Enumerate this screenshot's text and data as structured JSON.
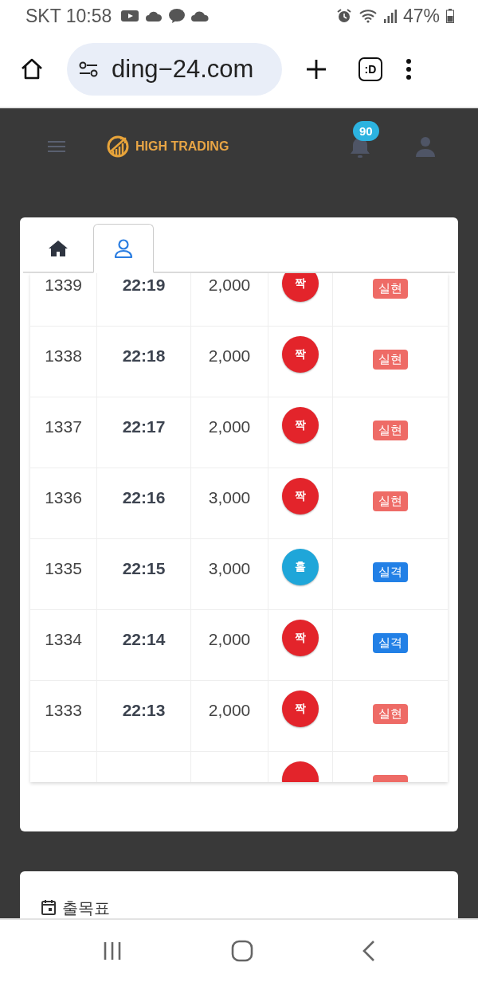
{
  "status_bar": {
    "carrier": "SKT",
    "time": "10:58",
    "battery": "47%"
  },
  "browser": {
    "url": "ding−24.com",
    "tab_button": ":D"
  },
  "header": {
    "brand": "HIGH TRADING",
    "notification_count": "90"
  },
  "tabs": [
    {
      "kind": "home",
      "selected": false
    },
    {
      "kind": "user",
      "selected": true
    }
  ],
  "rows": [
    {
      "number": "1339",
      "time": "22:19",
      "amount": "2,000",
      "ball": {
        "label": "짝",
        "kind": "even"
      },
      "result": {
        "label": "실현",
        "kind": "win"
      }
    },
    {
      "number": "1338",
      "time": "22:18",
      "amount": "2,000",
      "ball": {
        "label": "짝",
        "kind": "even"
      },
      "result": {
        "label": "실현",
        "kind": "win"
      }
    },
    {
      "number": "1337",
      "time": "22:17",
      "amount": "2,000",
      "ball": {
        "label": "짝",
        "kind": "even"
      },
      "result": {
        "label": "실현",
        "kind": "win"
      }
    },
    {
      "number": "1336",
      "time": "22:16",
      "amount": "3,000",
      "ball": {
        "label": "짝",
        "kind": "even"
      },
      "result": {
        "label": "실현",
        "kind": "win"
      }
    },
    {
      "number": "1335",
      "time": "22:15",
      "amount": "3,000",
      "ball": {
        "label": "홀",
        "kind": "odd"
      },
      "result": {
        "label": "실격",
        "kind": "loss"
      }
    },
    {
      "number": "1334",
      "time": "22:14",
      "amount": "2,000",
      "ball": {
        "label": "짝",
        "kind": "even"
      },
      "result": {
        "label": "실격",
        "kind": "loss"
      }
    },
    {
      "number": "1333",
      "time": "22:13",
      "amount": "2,000",
      "ball": {
        "label": "짝",
        "kind": "even"
      },
      "result": {
        "label": "실현",
        "kind": "win"
      }
    },
    {
      "ball": {
        "kind": "even"
      },
      "result": {
        "kind": "win"
      }
    }
  ],
  "panel": {
    "title": "출목표"
  }
}
